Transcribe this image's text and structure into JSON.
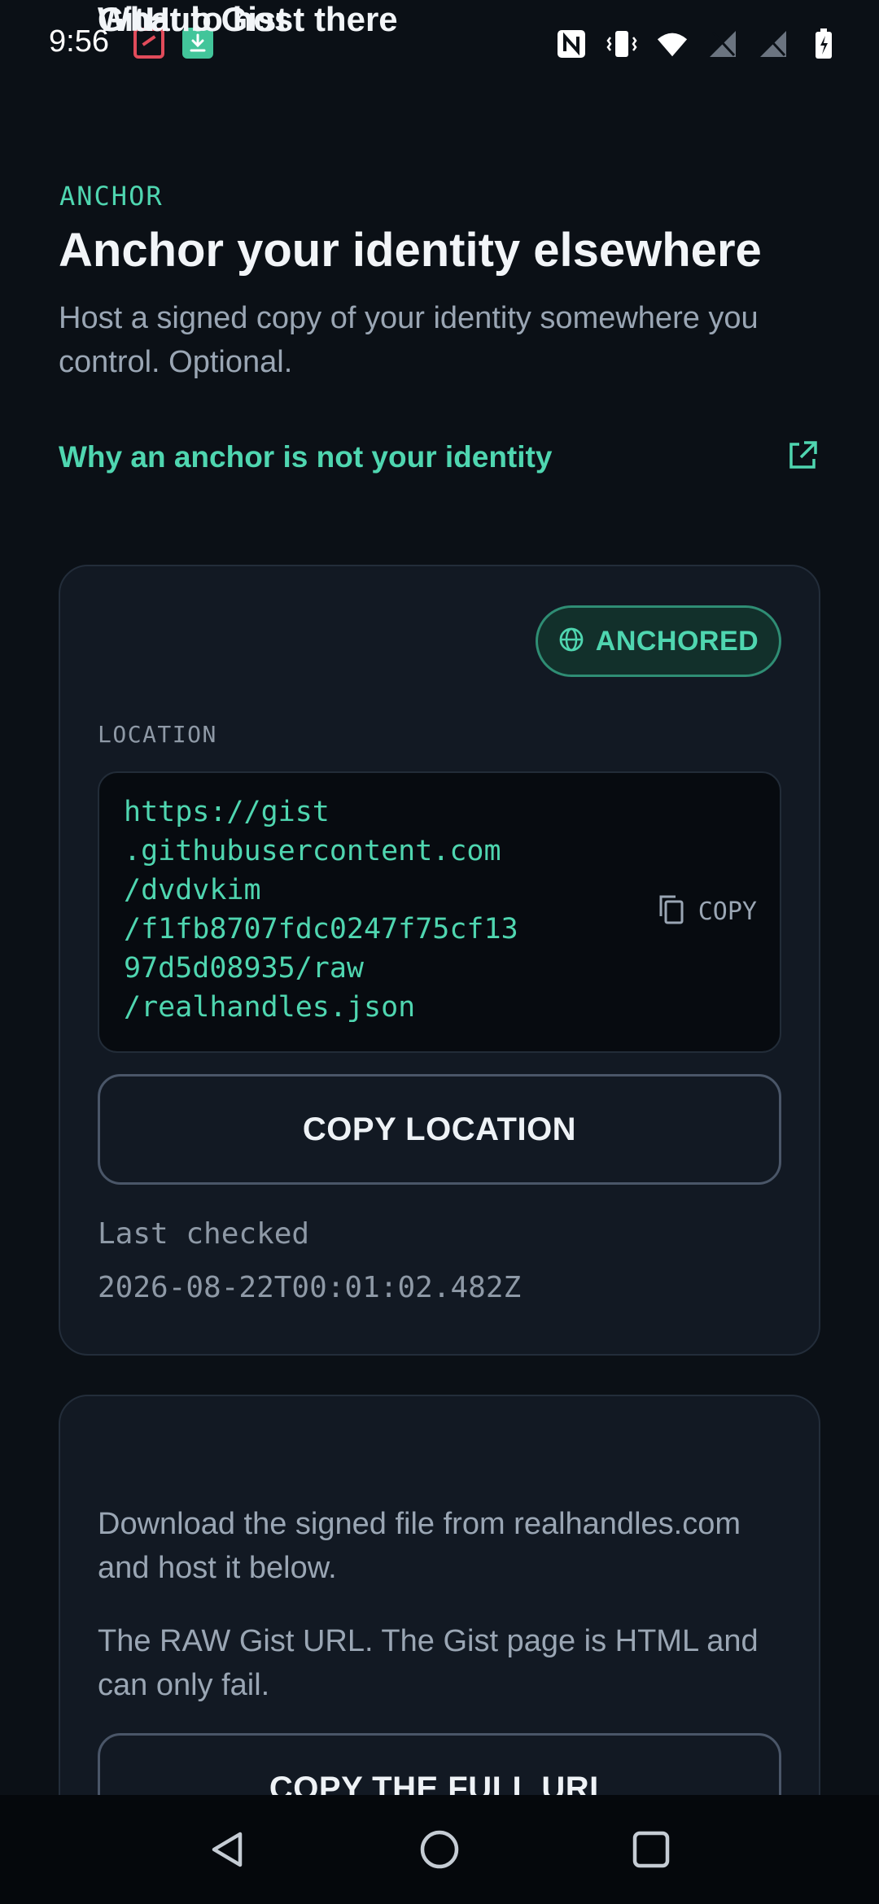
{
  "status_bar": {
    "time": "9:56",
    "icons": [
      "scissors-notification-icon",
      "download-notification-icon",
      "nfc-icon",
      "vibrate-icon",
      "wifi-icon",
      "signal-off-icon",
      "signal-off-icon",
      "battery-charging-icon"
    ]
  },
  "header": {
    "eyebrow": "ANCHOR",
    "title": "Anchor your identity elsewhere",
    "subtitle": "Host a signed copy of your identity somewhere you control. Optional.",
    "link_label": "Why an anchor is not your identity"
  },
  "anchor_card": {
    "title": "GitHub Gist",
    "badge": "ANCHORED",
    "location_label": "LOCATION",
    "location_url": "https://gist\n.githubusercontent.com\n/dvdvkim\n/f1fb8707fdc0247f75cf13\n97d5d08935/raw\n/realhandles.json",
    "copy_inline_label": "COPY",
    "copy_location_button": "COPY LOCATION",
    "last_checked_label": "Last checked",
    "last_checked_value": "2026-08-22T00:01:02.482Z"
  },
  "host_card": {
    "title": "What to host there",
    "paragraph_1": "Download the signed file from realhandles.com and host it below.",
    "paragraph_2": "The RAW Gist URL. The Gist page is HTML and can only fail.",
    "button": "COPY THE FULL URL"
  },
  "colors": {
    "background": "#0b1016",
    "accent": "#4fd6b0",
    "card": "#121923",
    "muted_text": "#9aa6b4"
  }
}
